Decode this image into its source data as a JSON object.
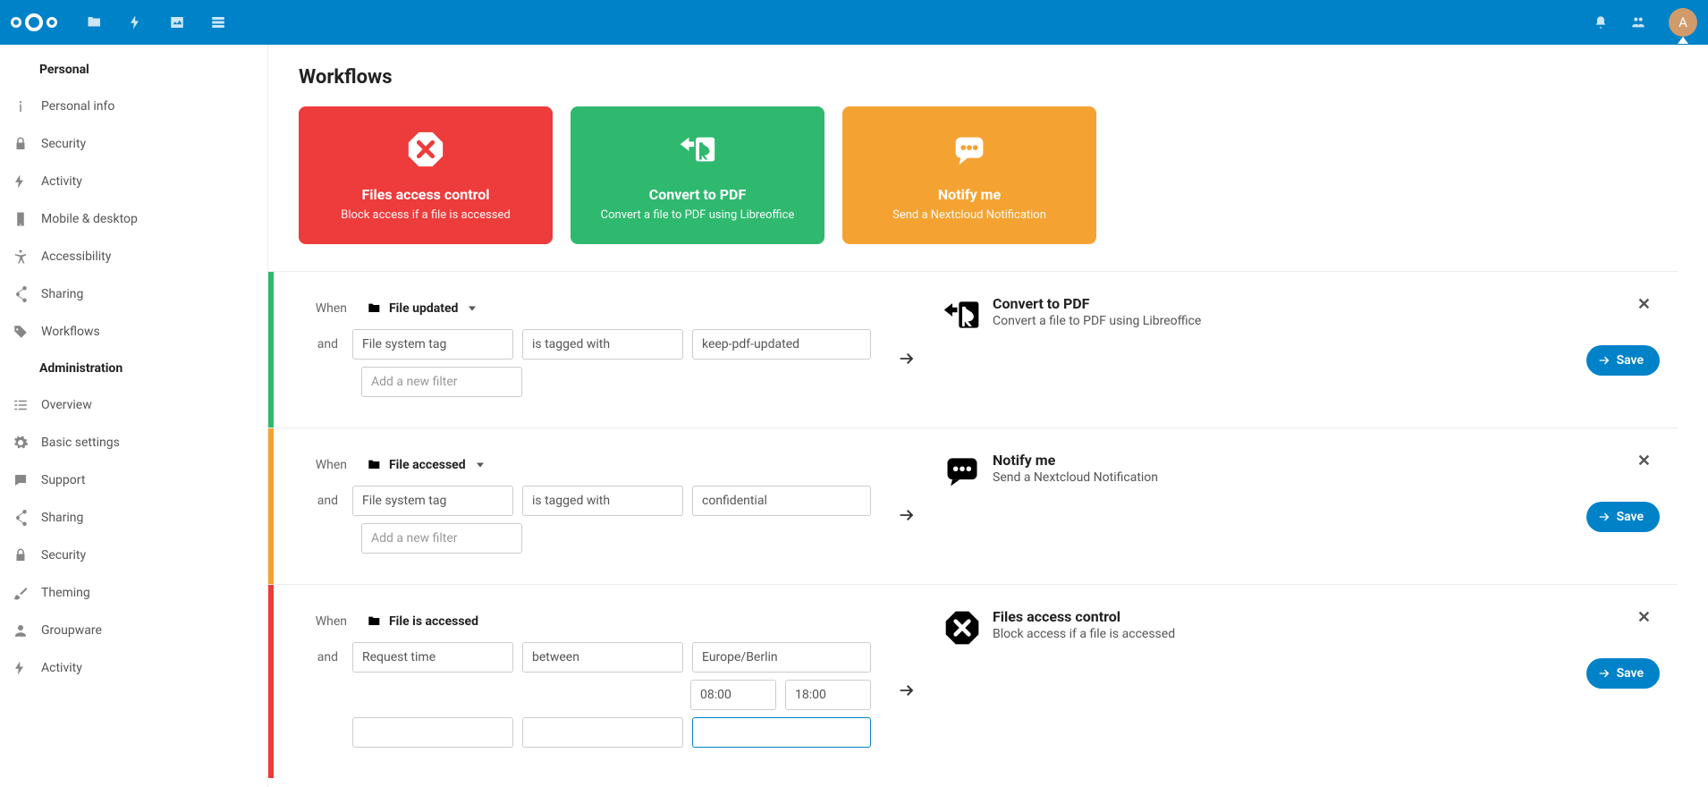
{
  "header": {
    "avatar_initial": "A"
  },
  "sidebar": {
    "personal_heading": "Personal",
    "personal": [
      {
        "label": "Personal info",
        "icon": "info"
      },
      {
        "label": "Security",
        "icon": "lock"
      },
      {
        "label": "Activity",
        "icon": "bolt"
      },
      {
        "label": "Mobile & desktop",
        "icon": "mobile"
      },
      {
        "label": "Accessibility",
        "icon": "accessibility"
      },
      {
        "label": "Sharing",
        "icon": "share"
      },
      {
        "label": "Workflows",
        "icon": "tag"
      }
    ],
    "admin_heading": "Administration",
    "admin": [
      {
        "label": "Overview",
        "icon": "list"
      },
      {
        "label": "Basic settings",
        "icon": "gear"
      },
      {
        "label": "Support",
        "icon": "chat"
      },
      {
        "label": "Sharing",
        "icon": "share"
      },
      {
        "label": "Security",
        "icon": "lock"
      },
      {
        "label": "Theming",
        "icon": "brush"
      },
      {
        "label": "Groupware",
        "icon": "user"
      },
      {
        "label": "Activity",
        "icon": "bolt"
      }
    ]
  },
  "page": {
    "title": "Workflows",
    "save_label": "Save"
  },
  "cards": [
    {
      "title": "Files access control",
      "desc": "Block access if a file is accessed",
      "color": "red"
    },
    {
      "title": "Convert to PDF",
      "desc": "Convert a file to PDF using Libreoffice",
      "color": "green"
    },
    {
      "title": "Notify me",
      "desc": "Send a Nextcloud Notification",
      "color": "orange"
    }
  ],
  "rules": [
    {
      "color": "green",
      "when_label": "When",
      "and_label": "and",
      "event": "File updated",
      "event_dropdown": true,
      "filters": [
        {
          "f1": "File system tag",
          "f2": "is tagged with",
          "f3": "keep-pdf-updated"
        }
      ],
      "add_filter_placeholder": "Add a new filter",
      "action": {
        "title": "Convert to PDF",
        "desc": "Convert a file to PDF using Libreoffice",
        "icon": "pdf"
      }
    },
    {
      "color": "orange",
      "when_label": "When",
      "and_label": "and",
      "event": "File accessed",
      "event_dropdown": true,
      "filters": [
        {
          "f1": "File system tag",
          "f2": "is tagged with",
          "f3": "confidential"
        }
      ],
      "add_filter_placeholder": "Add a new filter",
      "action": {
        "title": "Notify me",
        "desc": "Send a Nextcloud Notification",
        "icon": "chat"
      }
    },
    {
      "color": "red",
      "when_label": "When",
      "and_label": "and",
      "event": "File is accessed",
      "event_dropdown": false,
      "filters": [
        {
          "f1": "Request time",
          "f2": "between",
          "f3": "Europe/Berlin",
          "t1": "08:00",
          "t2": "18:00"
        }
      ],
      "add_filter_placeholder": "",
      "action": {
        "title": "Files access control",
        "desc": "Block access if a file is accessed",
        "icon": "block"
      }
    }
  ]
}
